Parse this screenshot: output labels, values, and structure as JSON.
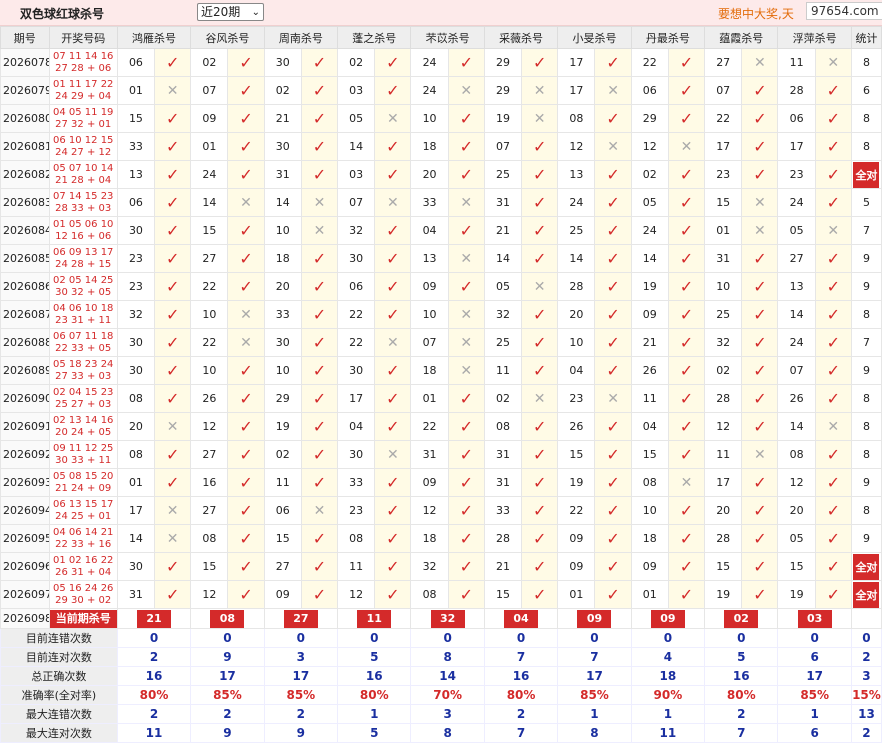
{
  "header": {
    "title": "双色球红球杀号",
    "range_select": "近20期",
    "slogan": "要想中大奖,天",
    "watermark": "97654.com"
  },
  "columns": {
    "period": "期号",
    "draw": "开奖号码",
    "experts": [
      "鸿雁杀号",
      "谷风杀号",
      "周南杀号",
      "蓬之杀号",
      "芣苡杀号",
      "采薇杀号",
      "小旻杀号",
      "丹最杀号",
      "蕴霞杀号",
      "浮萍杀号"
    ],
    "stat": "统计"
  },
  "rows": [
    {
      "period": "2026078",
      "draw": "07 11 14 16 27 28 + 06",
      "kills": [
        "06",
        "02",
        "30",
        "02",
        "24",
        "29",
        "17",
        "22",
        "27",
        "11"
      ],
      "marks": [
        1,
        1,
        1,
        1,
        1,
        1,
        1,
        1,
        0,
        0
      ],
      "count": "8"
    },
    {
      "period": "2026079",
      "draw": "01 11 17 22 24 29 + 04",
      "kills": [
        "01",
        "07",
        "02",
        "03",
        "24",
        "29",
        "17",
        "06",
        "07",
        "28"
      ],
      "marks": [
        0,
        1,
        1,
        1,
        0,
        0,
        0,
        1,
        1,
        1
      ],
      "count": "6"
    },
    {
      "period": "2026080",
      "draw": "04 05 11 19 27 32 + 01",
      "kills": [
        "15",
        "09",
        "21",
        "05",
        "10",
        "19",
        "08",
        "29",
        "22",
        "06"
      ],
      "marks": [
        1,
        1,
        1,
        0,
        1,
        0,
        1,
        1,
        1,
        1
      ],
      "count": "8"
    },
    {
      "period": "2026081",
      "draw": "06 10 12 15 24 27 + 12",
      "kills": [
        "33",
        "01",
        "30",
        "14",
        "18",
        "07",
        "12",
        "12",
        "17",
        "17"
      ],
      "marks": [
        1,
        1,
        1,
        1,
        1,
        1,
        0,
        0,
        1,
        1
      ],
      "count": "8"
    },
    {
      "period": "2026082",
      "draw": "05 07 10 14 21 28 + 04",
      "kills": [
        "13",
        "24",
        "31",
        "03",
        "20",
        "25",
        "13",
        "02",
        "23",
        "23"
      ],
      "marks": [
        1,
        1,
        1,
        1,
        1,
        1,
        1,
        1,
        1,
        1
      ],
      "count": "全对"
    },
    {
      "period": "2026083",
      "draw": "07 14 15 23 28 33 + 03",
      "kills": [
        "06",
        "14",
        "14",
        "07",
        "33",
        "31",
        "24",
        "05",
        "15",
        "24"
      ],
      "marks": [
        1,
        0,
        0,
        0,
        0,
        1,
        1,
        1,
        0,
        1
      ],
      "count": "5"
    },
    {
      "period": "2026084",
      "draw": "01 05 06 10 12 16 + 06",
      "kills": [
        "30",
        "15",
        "10",
        "32",
        "04",
        "21",
        "25",
        "24",
        "01",
        "05"
      ],
      "marks": [
        1,
        1,
        0,
        1,
        1,
        1,
        1,
        1,
        0,
        0
      ],
      "count": "7"
    },
    {
      "period": "2026085",
      "draw": "06 09 13 17 24 28 + 15",
      "kills": [
        "23",
        "27",
        "18",
        "30",
        "13",
        "14",
        "14",
        "14",
        "31",
        "27"
      ],
      "marks": [
        1,
        1,
        1,
        1,
        0,
        1,
        1,
        1,
        1,
        1
      ],
      "count": "9"
    },
    {
      "period": "2026086",
      "draw": "02 05 14 25 30 32 + 05",
      "kills": [
        "23",
        "22",
        "20",
        "06",
        "09",
        "05",
        "28",
        "19",
        "10",
        "13"
      ],
      "marks": [
        1,
        1,
        1,
        1,
        1,
        0,
        1,
        1,
        1,
        1
      ],
      "count": "9"
    },
    {
      "period": "2026087",
      "draw": "04 06 10 18 23 31 + 11",
      "kills": [
        "32",
        "10",
        "33",
        "22",
        "10",
        "32",
        "20",
        "09",
        "25",
        "14"
      ],
      "marks": [
        1,
        0,
        1,
        1,
        0,
        1,
        1,
        1,
        1,
        1
      ],
      "count": "8"
    },
    {
      "period": "2026088",
      "draw": "06 07 11 18 22 33 + 05",
      "kills": [
        "30",
        "22",
        "30",
        "22",
        "07",
        "25",
        "10",
        "21",
        "32",
        "24"
      ],
      "marks": [
        1,
        0,
        1,
        0,
        0,
        1,
        1,
        1,
        1,
        1
      ],
      "count": "7"
    },
    {
      "period": "2026089",
      "draw": "05 18 23 24 27 33 + 03",
      "kills": [
        "30",
        "10",
        "10",
        "30",
        "18",
        "11",
        "04",
        "26",
        "02",
        "07"
      ],
      "marks": [
        1,
        1,
        1,
        1,
        0,
        1,
        1,
        1,
        1,
        1
      ],
      "count": "9"
    },
    {
      "period": "2026090",
      "draw": "02 04 15 23 25 27 + 03",
      "kills": [
        "08",
        "26",
        "29",
        "17",
        "01",
        "02",
        "23",
        "11",
        "28",
        "26"
      ],
      "marks": [
        1,
        1,
        1,
        1,
        1,
        0,
        0,
        1,
        1,
        1
      ],
      "count": "8"
    },
    {
      "period": "2026091",
      "draw": "02 13 14 16 20 24 + 05",
      "kills": [
        "20",
        "12",
        "19",
        "04",
        "22",
        "08",
        "26",
        "04",
        "12",
        "14"
      ],
      "marks": [
        0,
        1,
        1,
        1,
        1,
        1,
        1,
        1,
        1,
        0
      ],
      "count": "8"
    },
    {
      "period": "2026092",
      "draw": "09 11 12 25 30 33 + 11",
      "kills": [
        "08",
        "27",
        "02",
        "30",
        "31",
        "31",
        "15",
        "15",
        "11",
        "08"
      ],
      "marks": [
        1,
        1,
        1,
        0,
        1,
        1,
        1,
        1,
        0,
        1
      ],
      "count": "8"
    },
    {
      "period": "2026093",
      "draw": "05 08 15 20 21 24 + 09",
      "kills": [
        "01",
        "16",
        "11",
        "33",
        "09",
        "31",
        "19",
        "08",
        "17",
        "12"
      ],
      "marks": [
        1,
        1,
        1,
        1,
        1,
        1,
        1,
        0,
        1,
        1
      ],
      "count": "9"
    },
    {
      "period": "2026094",
      "draw": "06 13 15 17 24 25 + 01",
      "kills": [
        "17",
        "27",
        "06",
        "23",
        "12",
        "33",
        "22",
        "10",
        "20",
        "20"
      ],
      "marks": [
        0,
        1,
        0,
        1,
        1,
        1,
        1,
        1,
        1,
        1
      ],
      "count": "8"
    },
    {
      "period": "2026095",
      "draw": "04 06 14 21 22 33 + 16",
      "kills": [
        "14",
        "08",
        "15",
        "08",
        "18",
        "28",
        "09",
        "18",
        "28",
        "05"
      ],
      "marks": [
        0,
        1,
        1,
        1,
        1,
        1,
        1,
        1,
        1,
        1
      ],
      "count": "9"
    },
    {
      "period": "2026096",
      "draw": "01 02 16 22 26 31 + 04",
      "kills": [
        "30",
        "15",
        "27",
        "11",
        "32",
        "21",
        "09",
        "09",
        "15",
        "15"
      ],
      "marks": [
        1,
        1,
        1,
        1,
        1,
        1,
        1,
        1,
        1,
        1
      ],
      "count": "全对"
    },
    {
      "period": "2026097",
      "draw": "05 16 24 26 29 30 + 02",
      "kills": [
        "31",
        "12",
        "09",
        "12",
        "08",
        "15",
        "01",
        "01",
        "19",
        "19"
      ],
      "marks": [
        1,
        1,
        1,
        1,
        1,
        1,
        1,
        1,
        1,
        1
      ],
      "count": "全对"
    }
  ],
  "current": {
    "period": "2026098",
    "label": "当前期杀号",
    "kills": [
      "21",
      "08",
      "27",
      "11",
      "32",
      "04",
      "09",
      "09",
      "02",
      "03"
    ]
  },
  "stats": [
    {
      "label": "目前连错次数",
      "values": [
        "0",
        "0",
        "0",
        "0",
        "0",
        "0",
        "0",
        "0",
        "0",
        "0",
        "0"
      ]
    },
    {
      "label": "目前连对次数",
      "values": [
        "2",
        "9",
        "3",
        "5",
        "8",
        "7",
        "7",
        "4",
        "5",
        "6",
        "2"
      ]
    },
    {
      "label": "总正确次数",
      "values": [
        "16",
        "17",
        "17",
        "16",
        "14",
        "16",
        "17",
        "18",
        "16",
        "17",
        "3"
      ]
    },
    {
      "label": "准确率(全对率)",
      "values": [
        "80%",
        "85%",
        "85%",
        "80%",
        "70%",
        "80%",
        "85%",
        "90%",
        "80%",
        "85%",
        "15%"
      ]
    },
    {
      "label": "最大连错次数",
      "values": [
        "2",
        "2",
        "2",
        "1",
        "3",
        "2",
        "1",
        "1",
        "2",
        "1",
        "13"
      ]
    },
    {
      "label": "最大连对次数",
      "values": [
        "11",
        "9",
        "9",
        "5",
        "8",
        "7",
        "8",
        "11",
        "7",
        "6",
        "2"
      ]
    }
  ],
  "symbols": {
    "ok": "✓",
    "no": "✕"
  },
  "colors": {
    "accent": "#d42a2a",
    "stat_blue": "#1a2fa0",
    "mark_bg": "#fffbe6"
  }
}
